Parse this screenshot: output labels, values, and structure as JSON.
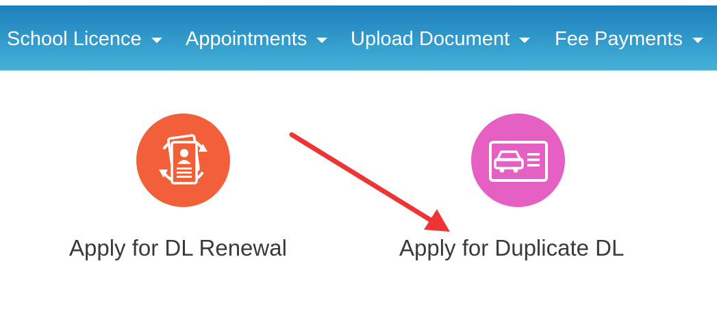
{
  "nav": {
    "items": [
      {
        "label": "School Licence"
      },
      {
        "label": "Appointments"
      },
      {
        "label": "Upload Document"
      },
      {
        "label": "Fee Payments"
      }
    ]
  },
  "services": [
    {
      "label": "Apply for DL Renewal",
      "icon": "license-renewal-icon",
      "color": "#f2603a"
    },
    {
      "label": "Apply for Duplicate DL",
      "icon": "car-license-card-icon",
      "color": "#e660c4"
    }
  ],
  "annotation": {
    "arrow_color": "#ee3535"
  }
}
